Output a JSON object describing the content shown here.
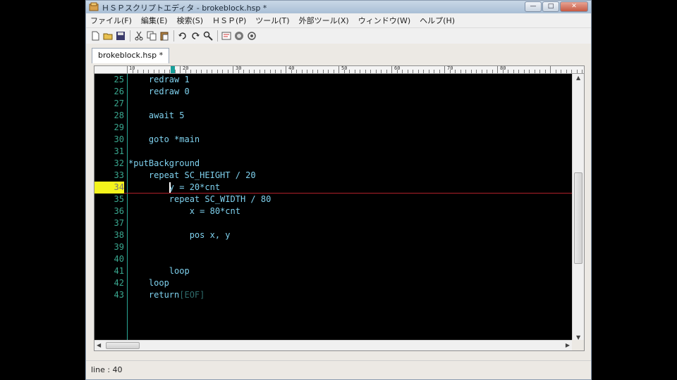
{
  "window": {
    "title": "ＨＳＰスクリプトエディタ - brokeblock.hsp *",
    "minimize_label": "—",
    "maximize_label": "□",
    "close_label": "✕"
  },
  "menu": [
    {
      "label": "ファイル(F)"
    },
    {
      "label": "編集(E)"
    },
    {
      "label": "検索(S)"
    },
    {
      "label": "ＨＳＰ(P)"
    },
    {
      "label": "ツール(T)"
    },
    {
      "label": "外部ツール(X)"
    },
    {
      "label": "ウィンドウ(W)"
    },
    {
      "label": "ヘルプ(H)"
    }
  ],
  "toolbar": {
    "icons": [
      "new-file-icon",
      "open-folder-icon",
      "save-icon",
      "cut-icon",
      "copy-icon",
      "paste-icon",
      "undo-icon",
      "redo-icon",
      "find-icon",
      "compile-icon",
      "run-icon",
      "debug-icon"
    ]
  },
  "tab": {
    "label": "brokeblock.hsp *"
  },
  "ruler": {
    "labels": [
      "10",
      "20",
      "30",
      "40",
      "50",
      "60",
      "70",
      "80"
    ]
  },
  "code": {
    "lines": [
      {
        "num": "25",
        "text": "    redraw 1"
      },
      {
        "num": "26",
        "text": "    redraw 0"
      },
      {
        "num": "27",
        "text": ""
      },
      {
        "num": "28",
        "text": "    await 5"
      },
      {
        "num": "29",
        "text": ""
      },
      {
        "num": "30",
        "text": "    goto *main"
      },
      {
        "num": "31",
        "text": ""
      },
      {
        "num": "32",
        "text": "*putBackground"
      },
      {
        "num": "33",
        "text": "    repeat SC_HEIGHT / 20"
      },
      {
        "num": "34",
        "text": "        y = 20*cnt"
      },
      {
        "num": "35",
        "text": "        repeat SC_WIDTH / 80"
      },
      {
        "num": "36",
        "text": "            x = 80*cnt"
      },
      {
        "num": "37",
        "text": ""
      },
      {
        "num": "38",
        "text": "            pos x, y"
      },
      {
        "num": "39",
        "text": ""
      },
      {
        "num": "40",
        "text": ""
      },
      {
        "num": "41",
        "text": "        loop"
      },
      {
        "num": "42",
        "text": "    loop"
      },
      {
        "num": "43",
        "text": "    return"
      }
    ],
    "eof_marker": "[EOF]",
    "current_line_num": "34"
  },
  "status": {
    "text": "line : 40"
  },
  "colors": {
    "editor_bg": "#000000",
    "code_text": "#7fd2ef",
    "line_number": "#3aa890",
    "current_line_highlight": "#f4f41c",
    "current_line_underline": "#b0202a"
  }
}
